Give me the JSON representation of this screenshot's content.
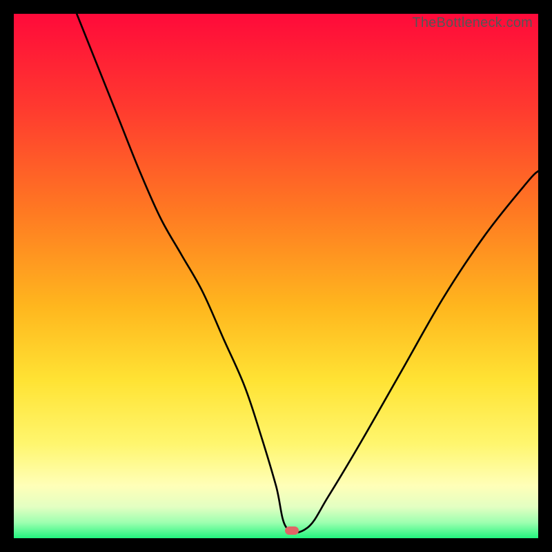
{
  "watermark": "TheBottleneck.com",
  "colors": {
    "black": "#000000",
    "curve": "#000000",
    "marker": "#e06666",
    "gradient_top": "#ff0a3a",
    "gradient_mid_red": "#ff4a2a",
    "gradient_orange": "#ff9220",
    "gradient_yellow": "#ffd223",
    "gradient_lightyellow": "#fff05a",
    "gradient_paleyellow": "#ffffaa",
    "gradient_palegreen": "#c8ffb7",
    "gradient_green": "#2dff87"
  },
  "chart_data": {
    "type": "line",
    "title": "",
    "xlabel": "",
    "ylabel": "",
    "xlim": [
      0,
      100
    ],
    "ylim": [
      0,
      100
    ],
    "grid": false,
    "legend": false,
    "annotations": [
      "TheBottleneck.com"
    ],
    "marker": {
      "x": 53,
      "y": 1.5
    },
    "series": [
      {
        "name": "bottleneck-curve",
        "x": [
          12,
          16,
          20,
          24,
          28,
          32,
          36,
          40,
          44,
          47,
          50,
          52,
          56,
          60,
          66,
          74,
          82,
          90,
          98,
          100
        ],
        "values": [
          100,
          90,
          80,
          70,
          61,
          54,
          47,
          38,
          29,
          20,
          10,
          2,
          2,
          8,
          18,
          32,
          46,
          58,
          68,
          70
        ]
      }
    ]
  }
}
